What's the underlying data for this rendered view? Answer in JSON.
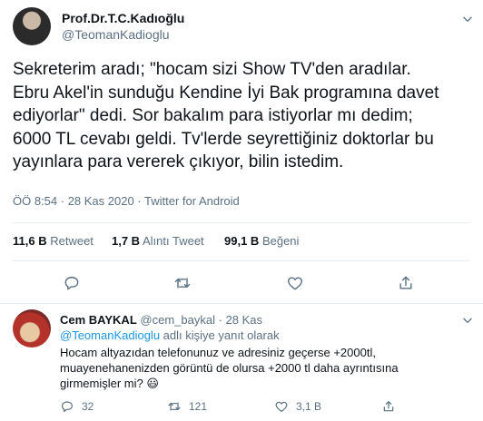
{
  "tweet": {
    "author_name": "Prof.Dr.T.C.Kadıoğlu",
    "author_handle": "@TeomanKadioglu",
    "text_lines": [
      "Sekreterim aradı; \"hocam sizi Show TV'den aradılar.",
      "Ebru Akel'in sunduğu Kendine İyi Bak programına davet",
      "ediyorlar\" dedi. Sor bakalım para istiyorlar mı dedim;",
      "6000 TL cevabı geldi. Tv'lerde seyrettiğiniz doktorlar bu",
      "yayınlara para vererek çıkıyor, bilin istedim."
    ],
    "timestamp": "ÖÖ 8:54 · 28 Kas 2020 · Twitter for Android",
    "stats": {
      "retweets_value": "11,6 B",
      "retweets_label": "Retweet",
      "quotes_value": "1,7 B",
      "quotes_label": "Alıntı Tweet",
      "likes_value": "99,1 B",
      "likes_label": "Beğeni"
    },
    "actions": [
      "reply-icon",
      "retweet-icon",
      "like-icon",
      "share-icon"
    ],
    "more_icon": "chevron-down-icon"
  },
  "reply": {
    "author_name": "Cem BAYKAL",
    "author_handle": "@cem_baykal",
    "separator": "·",
    "date": "28 Kas",
    "replying_to_handle": "@TeomanKadioglu",
    "replying_to_suffix": "adlı kişiye yanıt olarak",
    "text_lines": [
      "Hocam altyazıdan telefonunuz ve adresiniz geçerse +2000tl,",
      "muayenehanenizden görüntü de olursa +2000 tl daha ayrıntısına",
      "girmemişler mi?"
    ],
    "emoji": "😃",
    "reply_count": "32",
    "retweet_count": "121",
    "like_count": "3,1 B"
  },
  "colors": {
    "accent": "#1b95e0",
    "muted": "#5b7083",
    "divider": "#e6ecf0",
    "text": "#0f1419"
  }
}
